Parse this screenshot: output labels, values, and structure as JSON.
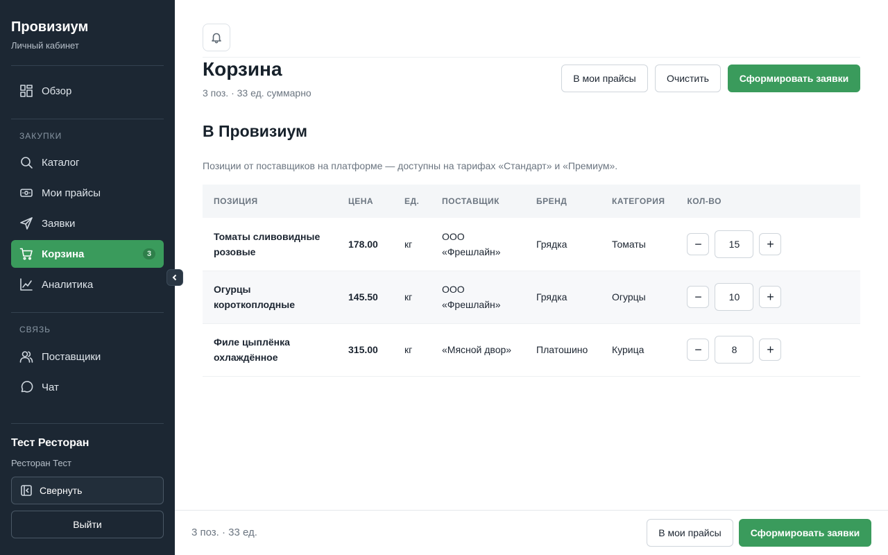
{
  "sidebar": {
    "title": "Провизиум",
    "subtitle": "Личный кабинет",
    "overview": "Обзор",
    "section_purchases": "ЗАКУПКИ",
    "catalog": "Каталог",
    "my_prices": "Мои прайсы",
    "orders": "Заявки",
    "cart": "Корзина",
    "cart_badge": "3",
    "analytics": "Аналитика",
    "section_contact": "СВЯЗЬ",
    "suppliers": "Поставщики",
    "chat": "Чат",
    "user_name": "Тест Ресторан",
    "user_sub": "Ресторан Тест",
    "collapse": "Свернуть",
    "logout": "Выйти"
  },
  "header": {
    "title": "Корзина",
    "subtitle": "3 поз. · 33 ед. суммарно",
    "to_prices": "В мои прайсы",
    "clear": "Очистить",
    "create_orders": "Сформировать заявки"
  },
  "section": {
    "title": "В Провизиум",
    "description": "Позиции от поставщиков на платформе — доступны на тарифах «Стандарт» и «Премиум»."
  },
  "table": {
    "columns": [
      "ПОЗИЦИЯ",
      "ЦЕНА",
      "ЕД.",
      "ПОСТАВЩИК",
      "БРЕНД",
      "КАТЕГОРИЯ",
      "КОЛ-ВО"
    ],
    "rows": [
      {
        "position": "Томаты сливовидные розовые",
        "price": "178.00",
        "unit": "кг",
        "supplier": "ООО «Фрешлайн»",
        "brand": "Грядка",
        "category": "Томаты",
        "qty": "15"
      },
      {
        "position": "Огурцы короткоплодные",
        "price": "145.50",
        "unit": "кг",
        "supplier": "ООО «Фрешлайн»",
        "brand": "Грядка",
        "category": "Огурцы",
        "qty": "10"
      },
      {
        "position": "Филе цыплёнка охлаждённое",
        "price": "315.00",
        "unit": "кг",
        "supplier": "«Мясной двор»",
        "brand": "Платошино",
        "category": "Курица",
        "qty": "8"
      }
    ],
    "minus": "−",
    "plus": "+"
  },
  "footer": {
    "summary": "3 поз. · 33 ед.",
    "to_prices": "В мои прайсы",
    "create_orders": "Сформировать заявки"
  },
  "icons": {
    "overview": "grid-icon",
    "catalog": "search-icon",
    "my_prices": "price-tag-icon",
    "orders": "send-icon",
    "cart": "cart-icon",
    "analytics": "chart-icon",
    "suppliers": "users-icon",
    "chat": "chat-icon",
    "collapse": "collapse-panel-icon",
    "notifications": "bell-icon"
  },
  "colors": {
    "accent": "#3a9b5c",
    "sidebar_bg": "#1c2733"
  }
}
